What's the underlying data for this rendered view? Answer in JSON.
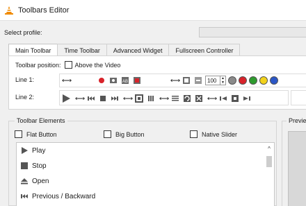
{
  "window": {
    "title": "Toolbars Editor"
  },
  "profile": {
    "label": "Select profile:",
    "value": ""
  },
  "tabs": [
    {
      "label": "Main Toolbar",
      "active": true
    },
    {
      "label": "Time Toolbar",
      "active": false
    },
    {
      "label": "Advanced Widget",
      "active": false
    },
    {
      "label": "Fullscreen Controller",
      "active": false
    }
  ],
  "toolbar_position": {
    "label": "Toolbar position:",
    "option": "Above the Video",
    "checked": false
  },
  "line1": {
    "label": "Line 1:",
    "spinner_value": "100"
  },
  "line2": {
    "label": "Line 2:"
  },
  "elements": {
    "title": "Toolbar Elements",
    "options": [
      {
        "label": "Flat Button",
        "checked": false
      },
      {
        "label": "Big Button",
        "checked": false
      },
      {
        "label": "Native Slider",
        "checked": false
      }
    ],
    "items": [
      {
        "label": "Play",
        "icon": "play-icon"
      },
      {
        "label": "Stop",
        "icon": "stop-icon"
      },
      {
        "label": "Open",
        "icon": "eject-icon"
      },
      {
        "label": "Previous / Backward",
        "icon": "previous-icon"
      }
    ]
  },
  "preview": {
    "title": "Preview"
  },
  "colors": {
    "accent_red": "#d8232a",
    "dot_colors": [
      "#8a8a8a",
      "#d8232a",
      "#2e9b2e",
      "#f2d21b",
      "#2a56c6"
    ]
  }
}
